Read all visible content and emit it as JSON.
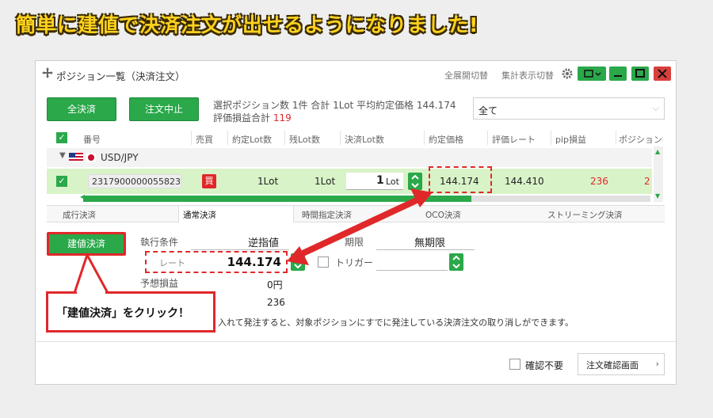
{
  "headline": "簡単に建値で決済注文が出せるようになりました!",
  "window": {
    "title": "ポジション一覧（決済注文）",
    "links": [
      "全展開切替",
      "集計表示切替"
    ]
  },
  "buttons": {
    "close_all": "全決済",
    "cancel_order": "注文中止"
  },
  "summary": {
    "line1": "選択ポジション数 1件  合計 1Lot 平均約定価格 144.174",
    "line2_label": "評価損益合計",
    "line2_value": "119"
  },
  "filter": {
    "selected": "全て"
  },
  "table": {
    "headers": [
      "番号",
      "売買",
      "約定Lot数",
      "残Lot数",
      "決済Lot数",
      "約定価格",
      "評価レート",
      "pip損益",
      "ポジション損益"
    ],
    "group": {
      "pair": "USD/JPY"
    },
    "row": {
      "id": "2317900000055823",
      "side": "買",
      "exec_lots": "1Lot",
      "remaining_lots": "1Lot",
      "settle_lots_num": "1",
      "settle_lots_unit": "Lot",
      "exec_price": "144.174",
      "rate": "144.410",
      "pip_pl": "236",
      "position_pl": "2"
    }
  },
  "tabs": [
    "成行決済",
    "通常決済",
    "時間指定決済",
    "OCO決済",
    "ストリーミング決済"
  ],
  "order": {
    "breakeven_button": "建値決済",
    "exec_condition_label": "執行条件",
    "exec_condition_value": "逆指値",
    "rate_placeholder": "レート",
    "rate_value": "144.174",
    "expiry_label": "期限",
    "expiry_value": "無期限",
    "trigger_label": "トリガー",
    "expected_pl_label": "予想損益",
    "expected_pl_value": "0円",
    "pip_value": "236",
    "notice": "入れて発注すると、対象ポジションにすでに発注している決済注文の取り消しができます。"
  },
  "callout_text": "「建値決済」をクリック！",
  "footer": {
    "no_confirm": "確認不要",
    "confirm_screen": "注文確認画面"
  }
}
